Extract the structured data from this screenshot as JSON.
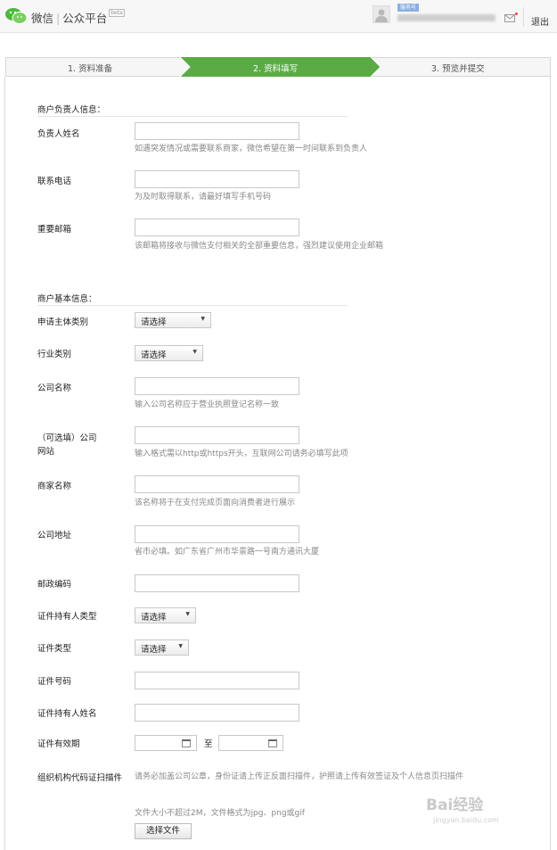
{
  "header": {
    "brand": "微信",
    "platform": "公众平台",
    "badge": "beta",
    "user_tag": "服务号",
    "logout": "退出"
  },
  "steps": [
    {
      "label": "1. 资料准备",
      "active": false
    },
    {
      "label": "2. 资料填写",
      "active": true
    },
    {
      "label": "3. 预览并提交",
      "active": false
    }
  ],
  "colors": {
    "accent": "#5aab45",
    "hint": "#888888"
  },
  "owner_section": {
    "title": "商户负责人信息：",
    "fields": [
      {
        "label": "负责人姓名",
        "value": "",
        "hint": "如遇突发情况或需要联系商家，微信希望在第一时间联系到负责人"
      },
      {
        "label": "联系电话",
        "value": "",
        "hint": "为及时取得联系，请最好填写手机号码"
      },
      {
        "label": "重要邮箱",
        "value": "",
        "hint": "该邮箱将接收与微信支付相关的全部重要信息，强烈建议使用企业邮箱"
      }
    ]
  },
  "basic_section": {
    "title": "商户基本信息：",
    "subject_type": {
      "label": "申请主体类别",
      "value": "请选择"
    },
    "industry": {
      "label": "行业类别",
      "value": "请选择"
    },
    "company_name": {
      "label": "公司名称",
      "value": "",
      "hint": "输入公司名称应于营业执照登记名称一致"
    },
    "website": {
      "label": "（可选填）公司网站",
      "value": "",
      "hint": "输入格式需以http或https开头，互联网公司请务必填写此项"
    },
    "merchant_name": {
      "label": "商家名称",
      "value": "",
      "hint": "该名称将于在支付完成页面向消费者进行展示"
    },
    "address": {
      "label": "公司地址",
      "value": "",
      "hint": "省市必填。如广东省广州市华景路一号南方通讯大厦"
    },
    "postcode": {
      "label": "邮政编码",
      "value": ""
    },
    "holder_type": {
      "label": "证件持有人类型",
      "value": "请选择"
    },
    "id_type": {
      "label": "证件类型",
      "value": "请选择"
    },
    "id_number": {
      "label": "证件号码",
      "value": ""
    },
    "holder_name": {
      "label": "证件持有人姓名",
      "value": ""
    },
    "validity": {
      "label": "证件有效期",
      "to": "至"
    },
    "org_scan": {
      "label": "组织机构代码证扫描件",
      "hint": "请务必加盖公司公章，身份证请上传正反面扫描件，护照请上传有效签证及个人信息页扫描件",
      "size_hint": "文件大小不超过2M，文件格式为jpg、png或gif",
      "button": "选择文件"
    }
  },
  "watermark": {
    "main": "Bai经验",
    "sub": "jingyan.baidu.com"
  }
}
